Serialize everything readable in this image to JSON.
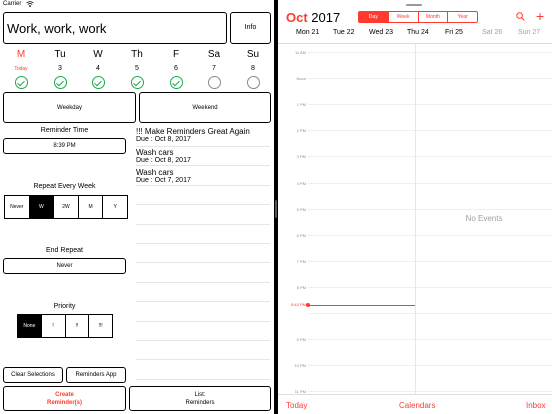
{
  "status": {
    "carrier": "Carrier"
  },
  "left": {
    "title": "Work, work, work",
    "info_label": "Info",
    "days": [
      {
        "letter": "M",
        "num": "Today",
        "today": true,
        "checked": true
      },
      {
        "letter": "Tu",
        "num": "3",
        "today": false,
        "checked": true
      },
      {
        "letter": "W",
        "num": "4",
        "today": false,
        "checked": true
      },
      {
        "letter": "Th",
        "num": "5",
        "today": false,
        "checked": true
      },
      {
        "letter": "F",
        "num": "6",
        "today": false,
        "checked": true
      },
      {
        "letter": "Sa",
        "num": "7",
        "today": false,
        "checked": false
      },
      {
        "letter": "Su",
        "num": "8",
        "today": false,
        "checked": false
      }
    ],
    "weekday_label": "Weekday",
    "weekend_label": "Weekend",
    "reminder_time_label": "Reminder Time",
    "reminder_time_value": "8:39 PM",
    "repeat_label": "Repeat Every Week",
    "repeat_options": [
      "Never",
      "W",
      "2W",
      "M",
      "Y"
    ],
    "repeat_selected": 1,
    "end_repeat_label": "End Repeat",
    "end_repeat_value": "Never",
    "priority_label": "Priority",
    "priority_options": [
      "None",
      "!",
      "!!",
      "!!!"
    ],
    "priority_selected": 0,
    "clear_label": "Clear Selections",
    "reminders_app_label": "Reminders App",
    "create_line1": "Create",
    "create_line2": "Reminder(s)",
    "list_line1": "List:",
    "list_line2": "Reminders",
    "reminders": [
      {
        "title": "!!! Make Reminders Great Again",
        "due": "Due : Oct 8, 2017"
      },
      {
        "title": "Wash cars",
        "due": "Due : Oct 8, 2017"
      },
      {
        "title": "Wash cars",
        "due": "Due : Oct 7, 2017"
      }
    ]
  },
  "right": {
    "month": "Oct",
    "year": "2017",
    "views": [
      "Day",
      "Week",
      "Month",
      "Year"
    ],
    "view_selected": 0,
    "week": [
      {
        "label": "Mon 21",
        "kind": "normal"
      },
      {
        "label": "Tue 22",
        "kind": "normal"
      },
      {
        "label": "Wed 23",
        "kind": "normal"
      },
      {
        "label": "Thu 24",
        "kind": "normal"
      },
      {
        "label": "Fri 25",
        "kind": "normal"
      },
      {
        "label": "Sat 26",
        "kind": "weekend"
      },
      {
        "label": "Sun 27",
        "kind": "weekend"
      }
    ],
    "hours": [
      "11 AM",
      "Noon",
      "1 PM",
      "2 PM",
      "3 PM",
      "4 PM",
      "5 PM",
      "6 PM",
      "7 PM",
      "8 PM",
      "",
      "9 PM",
      "10 PM",
      "11 PM",
      "12 AM"
    ],
    "now_label": "8:43 PM",
    "no_events": "No Events",
    "tabs": {
      "today": "Today",
      "calendars": "Calendars",
      "inbox": "Inbox"
    }
  },
  "colors": {
    "accent": "#ff3b30",
    "check_green": "#1ba94c"
  }
}
